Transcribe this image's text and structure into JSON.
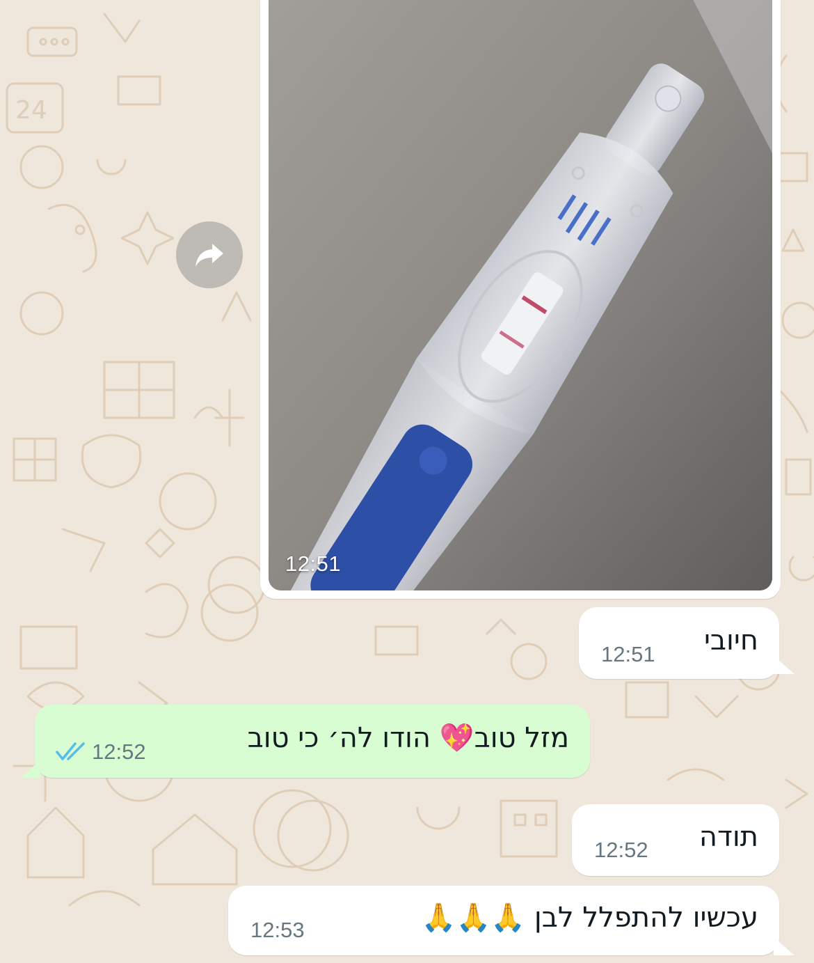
{
  "colors": {
    "wallpaper": "#efe7dc",
    "incoming_bubble": "#ffffff",
    "outgoing_bubble": "#d9fdd3",
    "timestamp": "#667781",
    "read_ticks": "#53bdeb"
  },
  "messages": [
    {
      "direction": "incoming",
      "type": "image",
      "image_description_icon": "pregnancy-test-photo",
      "time": "12:51"
    },
    {
      "direction": "incoming",
      "type": "text",
      "text": "חיובי",
      "time": "12:51"
    },
    {
      "direction": "outgoing",
      "type": "text",
      "text": "מזל טוב💖 הודו לה׳ כי טוב",
      "time": "12:52",
      "status_icon": "double-check-read-icon"
    },
    {
      "direction": "incoming",
      "type": "text",
      "text": "תודה",
      "time": "12:52"
    },
    {
      "direction": "incoming",
      "type": "text",
      "text": "עכשיו להתפלל לבן 🙏🙏🙏",
      "time": "12:53"
    }
  ],
  "forward_icon": "forward-arrow-icon"
}
